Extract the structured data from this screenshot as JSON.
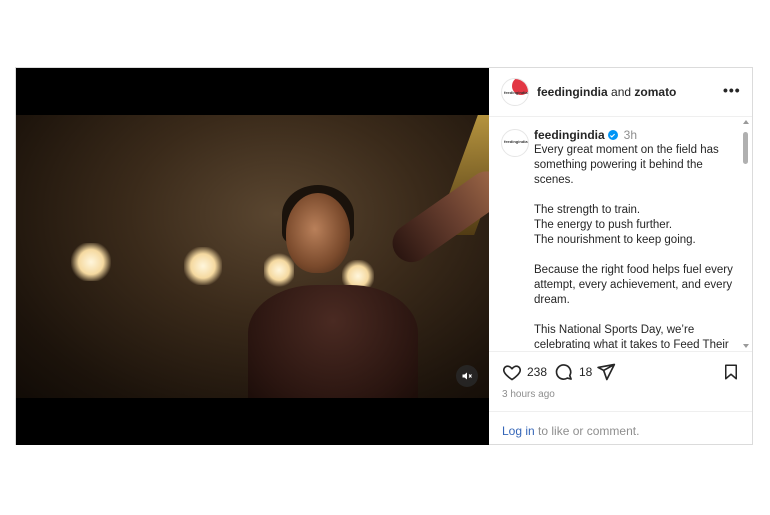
{
  "header": {
    "account": "feedingindia",
    "connector": "and",
    "collaborator": "zomato",
    "more_icon": "more-horizontal-icon",
    "avatar_text": "feedingindia"
  },
  "caption": {
    "username": "feedingindia",
    "time": "3h",
    "avatar_text": "feedingindia",
    "text": "Every great moment on the field has something powering it behind the scenes.\n\nThe strength to train.\nThe energy to push further.\nThe nourishment to keep going.\n\nBecause the right food helps fuel every attempt, every achievement, and every dream.\n\nThis National Sports Day, we’re celebrating what it takes to Feed Their"
  },
  "actions": {
    "likes": "238",
    "comments": "18"
  },
  "posted": "3 hours ago",
  "login": {
    "link": "Log in",
    "rest": " to like or comment."
  },
  "colors": {
    "accent_link": "#3566b8",
    "verified": "#0095f6",
    "brand_red": "#e23744"
  }
}
